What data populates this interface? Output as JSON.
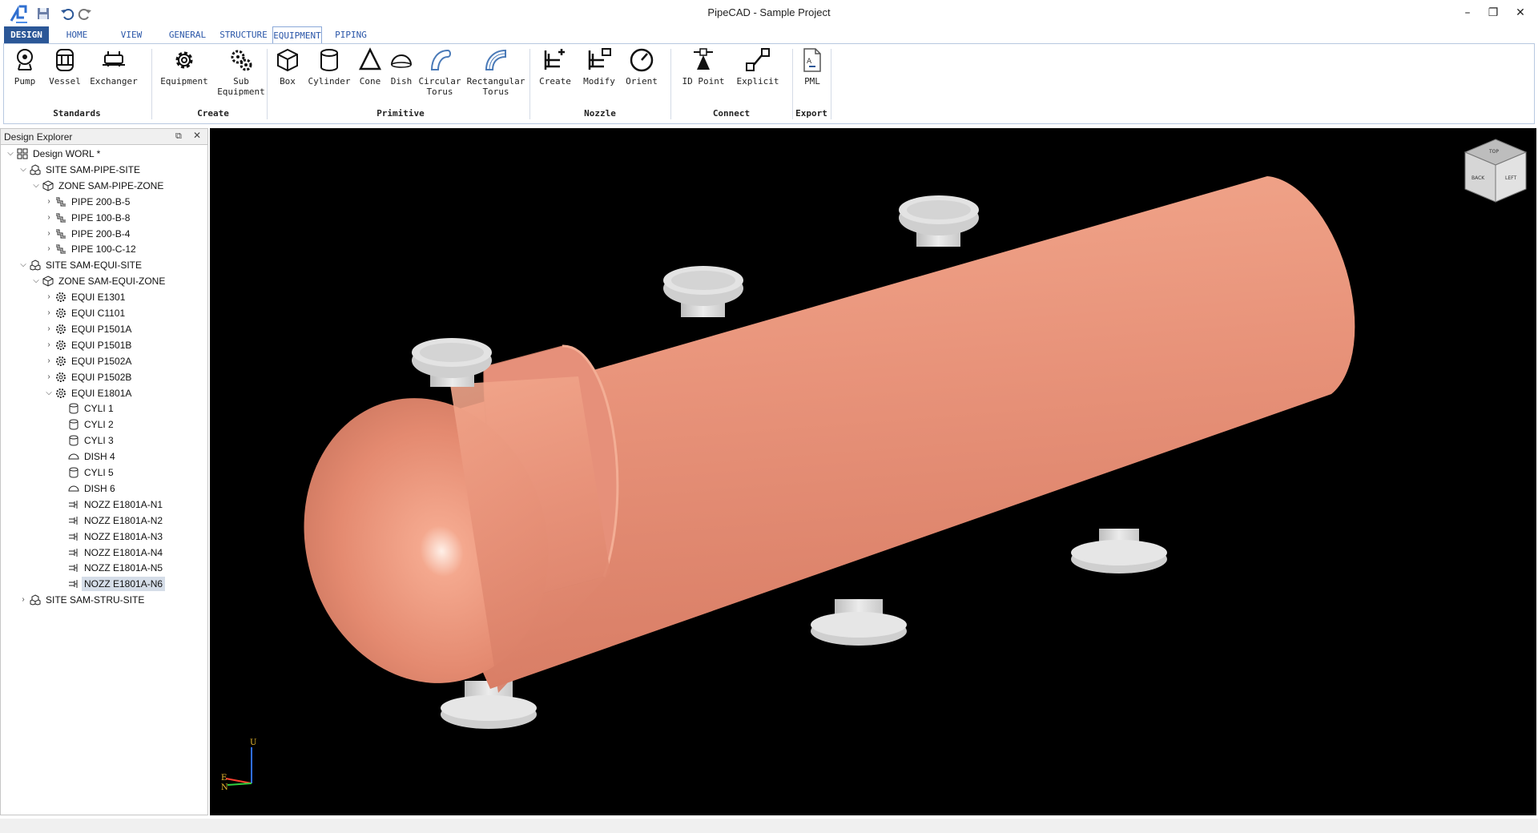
{
  "window": {
    "title": "PipeCAD - Sample Project",
    "controls": [
      "–",
      "❐",
      "✕"
    ]
  },
  "tabs": {
    "design": "DESIGN",
    "home": "HOME",
    "view": "VIEW",
    "general": "GENERAL",
    "structure": "STRUCTURE",
    "equipment": "EQUIPMENT",
    "piping": "PIPING",
    "active": "EQUIPMENT"
  },
  "ribbon": {
    "standards": {
      "label": "Standards",
      "buttons": [
        "Pump",
        "Vessel",
        "Exchanger"
      ]
    },
    "create": {
      "label": "Create",
      "equipment": "Equipment",
      "sub_line1": "Sub",
      "sub_line2": "Equipment"
    },
    "primitive": {
      "label": "Primitive",
      "box": "Box",
      "cylinder": "Cylinder",
      "cone": "Cone",
      "dish": "Dish",
      "ctorus_line1": "Circular",
      "ctorus_line2": "Torus",
      "rtorus_line1": "Rectangular",
      "rtorus_line2": "Torus"
    },
    "nozzle": {
      "label": "Nozzle",
      "buttons": [
        "Create",
        "Modify",
        "Orient"
      ]
    },
    "connect": {
      "label": "Connect",
      "buttons": [
        "ID Point",
        "Explicit"
      ]
    },
    "export": {
      "label": "Export",
      "buttons": [
        "PML"
      ]
    }
  },
  "explorer": {
    "title": "Design Explorer",
    "items": [
      {
        "label": "Design WORL *",
        "type": "world",
        "expanded": true
      },
      {
        "label": "SITE SAM-PIPE-SITE",
        "type": "site",
        "expanded": true
      },
      {
        "label": "ZONE SAM-PIPE-ZONE",
        "type": "zone",
        "expanded": true
      },
      {
        "label": "PIPE 200-B-5",
        "type": "pipe",
        "expanded": false
      },
      {
        "label": "PIPE 100-B-8",
        "type": "pipe",
        "expanded": false
      },
      {
        "label": "PIPE 200-B-4",
        "type": "pipe",
        "expanded": false
      },
      {
        "label": "PIPE 100-C-12",
        "type": "pipe",
        "expanded": false
      },
      {
        "label": "SITE SAM-EQUI-SITE",
        "type": "site",
        "expanded": true
      },
      {
        "label": "ZONE SAM-EQUI-ZONE",
        "type": "zone",
        "expanded": true
      },
      {
        "label": "EQUI E1301",
        "type": "equi",
        "expanded": false
      },
      {
        "label": "EQUI C1101",
        "type": "equi",
        "expanded": false
      },
      {
        "label": "EQUI P1501A",
        "type": "equi",
        "expanded": false
      },
      {
        "label": "EQUI P1501B",
        "type": "equi",
        "expanded": false
      },
      {
        "label": "EQUI P1502A",
        "type": "equi",
        "expanded": false
      },
      {
        "label": "EQUI P1502B",
        "type": "equi",
        "expanded": false
      },
      {
        "label": "EQUI E1801A",
        "type": "equi",
        "expanded": true
      },
      {
        "label": "CYLI 1",
        "type": "cyli"
      },
      {
        "label": "CYLI 2",
        "type": "cyli"
      },
      {
        "label": "CYLI 3",
        "type": "cyli"
      },
      {
        "label": "DISH 4",
        "type": "dish"
      },
      {
        "label": "CYLI 5",
        "type": "cyli"
      },
      {
        "label": "DISH 6",
        "type": "dish"
      },
      {
        "label": "NOZZ E1801A-N1",
        "type": "nozz"
      },
      {
        "label": "NOZZ E1801A-N2",
        "type": "nozz"
      },
      {
        "label": "NOZZ E1801A-N3",
        "type": "nozz"
      },
      {
        "label": "NOZZ E1801A-N4",
        "type": "nozz"
      },
      {
        "label": "NOZZ E1801A-N5",
        "type": "nozz"
      },
      {
        "label": "NOZZ E1801A-N6",
        "type": "nozz",
        "selected": true
      },
      {
        "label": "SITE SAM-STRU-SITE",
        "type": "site",
        "expanded": false
      }
    ]
  },
  "viewport": {
    "background": "#000000",
    "model_color": "#e8937a",
    "nozzle_color": "#d8d8d8",
    "axis_labels": {
      "up": "U",
      "east": "E",
      "north": "N"
    },
    "viewcube_faces": {
      "top": "TOP",
      "front": "BACK",
      "side": "LEFT"
    }
  },
  "colors": {
    "accent": "#2b5797",
    "tab_text": "#2a56a8"
  }
}
